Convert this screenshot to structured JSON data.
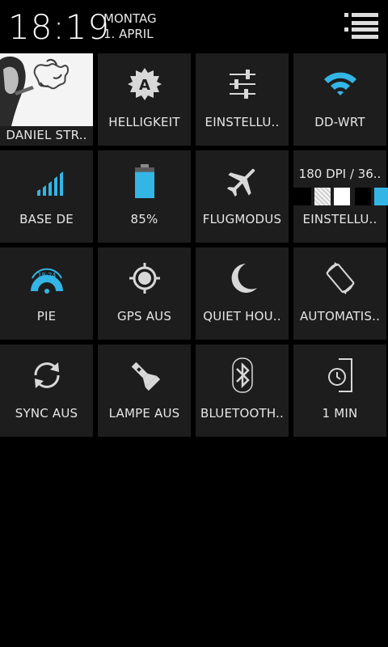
{
  "header": {
    "time": "18:19",
    "day": "MONTAG",
    "date": "1. APRIL"
  },
  "accent_color": "#33b5e5",
  "tiles": {
    "profile": {
      "label": "DANIEL STR..",
      "icon": "profile-photo"
    },
    "brightness": {
      "label": "HELLIGKEIT",
      "icon": "auto-brightness-icon"
    },
    "settings": {
      "label": "EINSTELLU..",
      "icon": "sliders-icon"
    },
    "wifi": {
      "label": "DD-WRT",
      "icon": "wifi-icon"
    },
    "signal": {
      "label": "BASE DE",
      "icon": "signal-bars-icon"
    },
    "battery": {
      "label": "85%",
      "icon": "battery-icon",
      "level_percent": 85
    },
    "airplane": {
      "label": "FLUGMODUS",
      "icon": "airplane-icon"
    },
    "dpi": {
      "value": "180 DPI / 36..",
      "label": "EINSTELLU..",
      "icon": "color-swatches"
    },
    "pie": {
      "label": "PIE",
      "icon": "pie-controls-icon"
    },
    "gps": {
      "label": "GPS AUS",
      "icon": "gps-icon"
    },
    "quiet": {
      "label": "QUIET HOU..",
      "icon": "moon-icon"
    },
    "rotation": {
      "label": "AUTOMATIS..",
      "icon": "rotate-icon"
    },
    "sync": {
      "label": "SYNC AUS",
      "icon": "sync-icon"
    },
    "torch": {
      "label": "LAMPE AUS",
      "icon": "flashlight-icon"
    },
    "bluetooth": {
      "label": "BLUETOOTH..",
      "icon": "bluetooth-icon"
    },
    "timeout": {
      "label": "1 MIN",
      "icon": "screen-timeout-icon"
    }
  }
}
